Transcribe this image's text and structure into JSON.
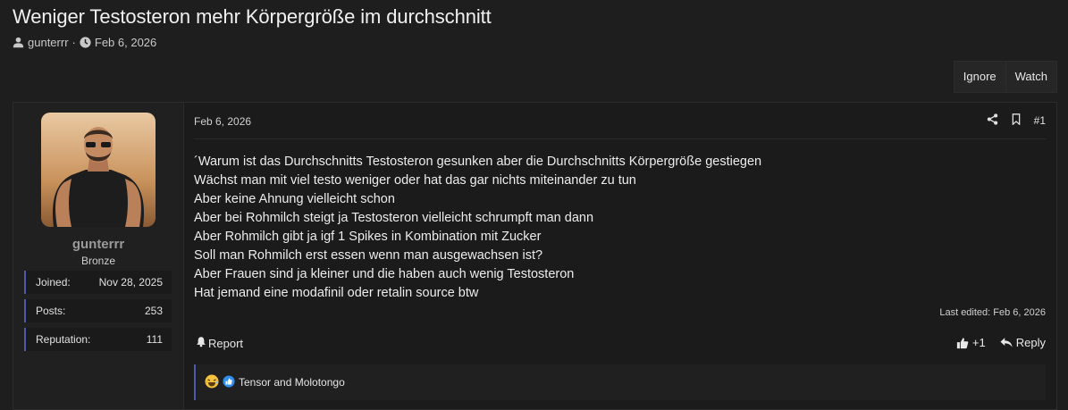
{
  "thread": {
    "title": "Weniger Testosteron mehr Körpergröße im durchschnitt",
    "author": "gunterrr",
    "meta_separator": "·",
    "date": "Feb 6, 2026"
  },
  "actions": {
    "ignore": "Ignore",
    "watch": "Watch"
  },
  "user": {
    "name": "gunterrr",
    "title": "Bronze",
    "stats": [
      {
        "label": "Joined:",
        "value": "Nov 28, 2025"
      },
      {
        "label": "Posts:",
        "value": "253"
      },
      {
        "label": "Reputation:",
        "value": "111"
      }
    ]
  },
  "post": {
    "date": "Feb 6, 2026",
    "number": "#1",
    "lines": [
      "´Warum ist das Durchschnitts Testosteron gesunken aber die Durchschnitts Körpergröße gestiegen",
      "Wächst man mit viel testo weniger oder hat das gar nichts miteinander zu tun",
      "Aber keine Ahnung vielleicht schon",
      "Aber bei Rohmilch steigt ja Testosteron vielleicht schrumpft man dann",
      "Aber Rohmilch gibt ja igf 1 Spikes in Kombination mit Zucker",
      "Soll man Rohmilch erst essen wenn man ausgewachsen ist?",
      "Aber Frauen sind ja kleiner und die haben auch wenig Testosteron",
      "Hat jemand eine modafinil oder retalin source btw"
    ],
    "last_edited": "Last edited: Feb 6, 2026",
    "report": "Report",
    "like": "+1",
    "reply": "Reply",
    "reactions_users": "Tensor and Molotongo"
  },
  "colors": {
    "accent": "#4f5aa8",
    "background": "#1e1e1e",
    "panel": "#202020"
  }
}
